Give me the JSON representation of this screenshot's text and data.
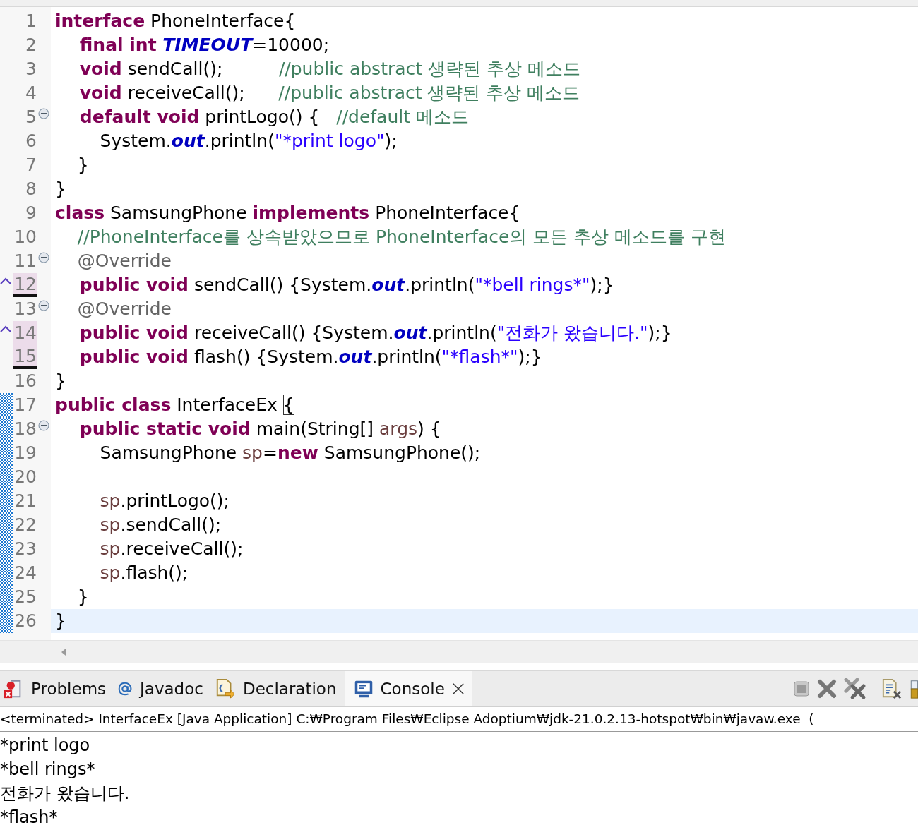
{
  "editor": {
    "lines": [
      {
        "number": "1",
        "fold": false,
        "override": false,
        "marked": false,
        "underlined": false,
        "changed": false,
        "current": false,
        "tokens": [
          {
            "kind": "keyword",
            "text": "interface"
          },
          {
            "kind": "plain",
            "text": " PhoneInterface{"
          }
        ]
      },
      {
        "number": "2",
        "fold": false,
        "override": false,
        "marked": false,
        "underlined": false,
        "changed": false,
        "current": false,
        "tokens": [
          {
            "kind": "keyword",
            "text": "    final int "
          },
          {
            "kind": "constant",
            "text": "TIMEOUT"
          },
          {
            "kind": "plain",
            "text": "=10000;"
          }
        ]
      },
      {
        "number": "3",
        "fold": false,
        "override": false,
        "marked": false,
        "underlined": false,
        "changed": false,
        "current": false,
        "tokens": [
          {
            "kind": "keyword",
            "text": "    void"
          },
          {
            "kind": "plain",
            "text": " sendCall();          "
          },
          {
            "kind": "comment",
            "text": "//public abstract 생략된 추상 메소드"
          }
        ]
      },
      {
        "number": "4",
        "fold": false,
        "override": false,
        "marked": false,
        "underlined": false,
        "changed": false,
        "current": false,
        "tokens": [
          {
            "kind": "keyword",
            "text": "    void"
          },
          {
            "kind": "plain",
            "text": " receiveCall();      "
          },
          {
            "kind": "comment",
            "text": "//public abstract 생략된 추상 메소드"
          }
        ]
      },
      {
        "number": "5",
        "fold": true,
        "override": false,
        "marked": false,
        "underlined": false,
        "changed": false,
        "current": false,
        "tokens": [
          {
            "kind": "keyword",
            "text": "    default void"
          },
          {
            "kind": "plain",
            "text": " printLogo() {   "
          },
          {
            "kind": "comment",
            "text": "//default 메소드"
          }
        ]
      },
      {
        "number": "6",
        "fold": false,
        "override": false,
        "marked": false,
        "underlined": false,
        "changed": false,
        "current": false,
        "tokens": [
          {
            "kind": "plain",
            "text": "        System."
          },
          {
            "kind": "field",
            "text": "out"
          },
          {
            "kind": "plain",
            "text": ".println("
          },
          {
            "kind": "string",
            "text": "\"*print logo\""
          },
          {
            "kind": "plain",
            "text": ");"
          }
        ]
      },
      {
        "number": "7",
        "fold": false,
        "override": false,
        "marked": false,
        "underlined": false,
        "changed": false,
        "current": false,
        "tokens": [
          {
            "kind": "plain",
            "text": "    }"
          }
        ]
      },
      {
        "number": "8",
        "fold": false,
        "override": false,
        "marked": false,
        "underlined": false,
        "changed": false,
        "current": false,
        "tokens": [
          {
            "kind": "plain",
            "text": "}"
          }
        ]
      },
      {
        "number": "9",
        "fold": false,
        "override": false,
        "marked": false,
        "underlined": false,
        "changed": false,
        "current": false,
        "tokens": [
          {
            "kind": "keyword",
            "text": "class"
          },
          {
            "kind": "plain",
            "text": " SamsungPhone "
          },
          {
            "kind": "keyword",
            "text": "implements"
          },
          {
            "kind": "plain",
            "text": " PhoneInterface{"
          }
        ]
      },
      {
        "number": "10",
        "fold": false,
        "override": false,
        "marked": false,
        "underlined": false,
        "changed": false,
        "current": false,
        "tokens": [
          {
            "kind": "comment",
            "text": "    //PhoneInterface를 상속받았으므로 PhoneInterface의 모든 추상 메소드를 구현"
          }
        ]
      },
      {
        "number": "11",
        "fold": true,
        "override": false,
        "marked": false,
        "underlined": false,
        "changed": false,
        "current": false,
        "tokens": [
          {
            "kind": "annotation",
            "text": "    @Override"
          }
        ]
      },
      {
        "number": "12",
        "fold": false,
        "override": true,
        "marked": true,
        "underlined": true,
        "changed": false,
        "current": false,
        "tokens": [
          {
            "kind": "keyword",
            "text": "    public void"
          },
          {
            "kind": "plain",
            "text": " sendCall() {System."
          },
          {
            "kind": "field",
            "text": "out"
          },
          {
            "kind": "plain",
            "text": ".println("
          },
          {
            "kind": "string",
            "text": "\"*bell rings*\""
          },
          {
            "kind": "plain",
            "text": ");}"
          }
        ]
      },
      {
        "number": "13",
        "fold": true,
        "override": false,
        "marked": false,
        "underlined": false,
        "changed": false,
        "current": false,
        "tokens": [
          {
            "kind": "annotation",
            "text": "    @Override"
          }
        ]
      },
      {
        "number": "14",
        "fold": false,
        "override": true,
        "marked": true,
        "underlined": false,
        "changed": false,
        "current": false,
        "tokens": [
          {
            "kind": "keyword",
            "text": "    public void"
          },
          {
            "kind": "plain",
            "text": " receiveCall() {System."
          },
          {
            "kind": "field",
            "text": "out"
          },
          {
            "kind": "plain",
            "text": ".println("
          },
          {
            "kind": "string",
            "text": "\"전화가 왔습니다.\""
          },
          {
            "kind": "plain",
            "text": ");}"
          }
        ]
      },
      {
        "number": "15",
        "fold": false,
        "override": false,
        "marked": true,
        "underlined": true,
        "changed": false,
        "current": false,
        "tokens": [
          {
            "kind": "keyword",
            "text": "    public void"
          },
          {
            "kind": "plain",
            "text": " flash() {System."
          },
          {
            "kind": "field",
            "text": "out"
          },
          {
            "kind": "plain",
            "text": ".println("
          },
          {
            "kind": "string",
            "text": "\"*flash*\""
          },
          {
            "kind": "plain",
            "text": ");}"
          }
        ]
      },
      {
        "number": "16",
        "fold": false,
        "override": false,
        "marked": false,
        "underlined": false,
        "changed": false,
        "current": false,
        "tokens": [
          {
            "kind": "plain",
            "text": "}"
          }
        ]
      },
      {
        "number": "17",
        "fold": false,
        "override": false,
        "marked": false,
        "underlined": false,
        "changed": true,
        "current": false,
        "tokens": [
          {
            "kind": "keyword",
            "text": "public class"
          },
          {
            "kind": "plain",
            "text": " InterfaceEx "
          },
          {
            "kind": "bracket",
            "text": "{"
          }
        ]
      },
      {
        "number": "18",
        "fold": true,
        "override": false,
        "marked": false,
        "underlined": false,
        "changed": true,
        "current": false,
        "tokens": [
          {
            "kind": "keyword",
            "text": "    public static void"
          },
          {
            "kind": "plain",
            "text": " main(String[] "
          },
          {
            "kind": "variable",
            "text": "args"
          },
          {
            "kind": "plain",
            "text": ") {"
          }
        ]
      },
      {
        "number": "19",
        "fold": false,
        "override": false,
        "marked": false,
        "underlined": false,
        "changed": true,
        "current": false,
        "tokens": [
          {
            "kind": "plain",
            "text": "        SamsungPhone "
          },
          {
            "kind": "variable",
            "text": "sp"
          },
          {
            "kind": "plain",
            "text": "="
          },
          {
            "kind": "keyword",
            "text": "new"
          },
          {
            "kind": "plain",
            "text": " SamsungPhone();"
          }
        ]
      },
      {
        "number": "20",
        "fold": false,
        "override": false,
        "marked": false,
        "underlined": false,
        "changed": true,
        "current": false
      },
      {
        "number": "21",
        "fold": false,
        "override": false,
        "marked": false,
        "underlined": false,
        "changed": true,
        "current": false,
        "tokens": [
          {
            "kind": "variable",
            "text": "        sp"
          },
          {
            "kind": "plain",
            "text": ".printLogo();"
          }
        ]
      },
      {
        "number": "22",
        "fold": false,
        "override": false,
        "marked": false,
        "underlined": false,
        "changed": true,
        "current": false,
        "tokens": [
          {
            "kind": "variable",
            "text": "        sp"
          },
          {
            "kind": "plain",
            "text": ".sendCall();"
          }
        ]
      },
      {
        "number": "23",
        "fold": false,
        "override": false,
        "marked": false,
        "underlined": false,
        "changed": true,
        "current": false,
        "tokens": [
          {
            "kind": "variable",
            "text": "        sp"
          },
          {
            "kind": "plain",
            "text": ".receiveCall();"
          }
        ]
      },
      {
        "number": "24",
        "fold": false,
        "override": false,
        "marked": false,
        "underlined": false,
        "changed": true,
        "current": false,
        "tokens": [
          {
            "kind": "variable",
            "text": "        sp"
          },
          {
            "kind": "plain",
            "text": ".flash();"
          }
        ]
      },
      {
        "number": "25",
        "fold": false,
        "override": false,
        "marked": false,
        "underlined": false,
        "changed": true,
        "current": false,
        "tokens": [
          {
            "kind": "plain",
            "text": "    }"
          }
        ]
      },
      {
        "number": "26",
        "fold": false,
        "override": false,
        "marked": false,
        "underlined": false,
        "changed": true,
        "current": true,
        "tokens": [
          {
            "kind": "plain",
            "text": "}"
          }
        ]
      }
    ]
  },
  "views": {
    "tabs": [
      {
        "kind": "problems",
        "label": "Problems",
        "selected": false
      },
      {
        "kind": "javadoc",
        "label": "Javadoc",
        "selected": false
      },
      {
        "kind": "declaration",
        "label": "Declaration",
        "selected": false
      },
      {
        "kind": "console",
        "label": "Console",
        "selected": true
      }
    ]
  },
  "console": {
    "header": "<terminated> InterfaceEx [Java Application] C:₩Program Files₩Eclipse Adoptium₩jdk-21.0.2.13-hotspot₩bin₩javaw.exe  (",
    "output": [
      "*print logo",
      "*bell rings*",
      "전화가 왔습니다.",
      "*flash*"
    ]
  }
}
